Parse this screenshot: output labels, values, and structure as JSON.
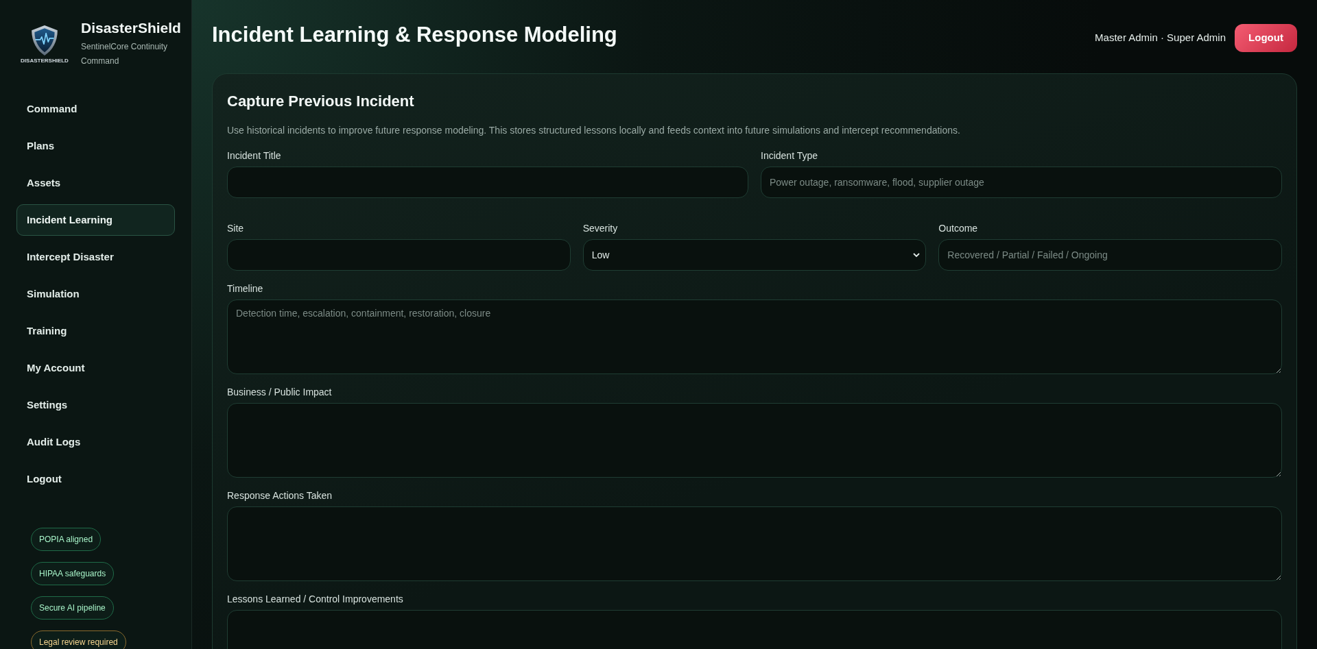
{
  "sidebar": {
    "brand": {
      "logo_caption": "DISASTERSHIELD",
      "name": "DisasterShield",
      "tagline": "SentinelCore Continuity Command"
    },
    "nav": [
      {
        "label": "Command",
        "selected": false
      },
      {
        "label": "Plans",
        "selected": false
      },
      {
        "label": "Assets",
        "selected": false
      },
      {
        "label": "Incident Learning",
        "selected": true
      },
      {
        "label": "Intercept Disaster",
        "selected": false
      },
      {
        "label": "Simulation",
        "selected": false
      },
      {
        "label": "Training",
        "selected": false
      },
      {
        "label": "My Account",
        "selected": false
      },
      {
        "label": "Settings",
        "selected": false
      },
      {
        "label": "Audit Logs",
        "selected": false
      },
      {
        "label": "Logout",
        "selected": false
      }
    ],
    "badges": [
      {
        "label": "POPIA aligned",
        "kind": "compliance"
      },
      {
        "label": "HIPAA safeguards",
        "kind": "compliance"
      },
      {
        "label": "Secure AI pipeline",
        "kind": "compliance"
      },
      {
        "label": "Legal review required",
        "kind": "caution"
      }
    ]
  },
  "header": {
    "title": "Incident Learning & Response Modeling",
    "user": "Master Admin · Super Admin",
    "logout": "Logout"
  },
  "form": {
    "title": "Capture Previous Incident",
    "description": "Use historical incidents to improve future response modeling. This stores structured lessons locally and feeds context into future simulations and intercept recommendations.",
    "rows": [
      [
        {
          "label": "Incident Title",
          "kind": "input"
        },
        {
          "label": "Incident Type",
          "kind": "input",
          "placeholder": "Power outage, ransomware, flood, supplier outage"
        }
      ],
      [
        {
          "label": "Site",
          "kind": "input"
        },
        {
          "label": "Severity",
          "kind": "select",
          "value": "Low"
        },
        {
          "label": "Outcome",
          "kind": "input",
          "placeholder": "Recovered / Partial / Failed / Ongoing"
        }
      ],
      [
        {
          "label": "Timeline",
          "kind": "textarea",
          "placeholder": "Detection time, escalation, containment, restoration, closure"
        }
      ],
      [
        {
          "label": "Business / Public Impact",
          "kind": "textarea"
        }
      ],
      [
        {
          "label": "Response Actions Taken",
          "kind": "textarea"
        }
      ],
      [
        {
          "label": "Lessons Learned / Control Improvements",
          "kind": "textarea"
        }
      ]
    ]
  }
}
